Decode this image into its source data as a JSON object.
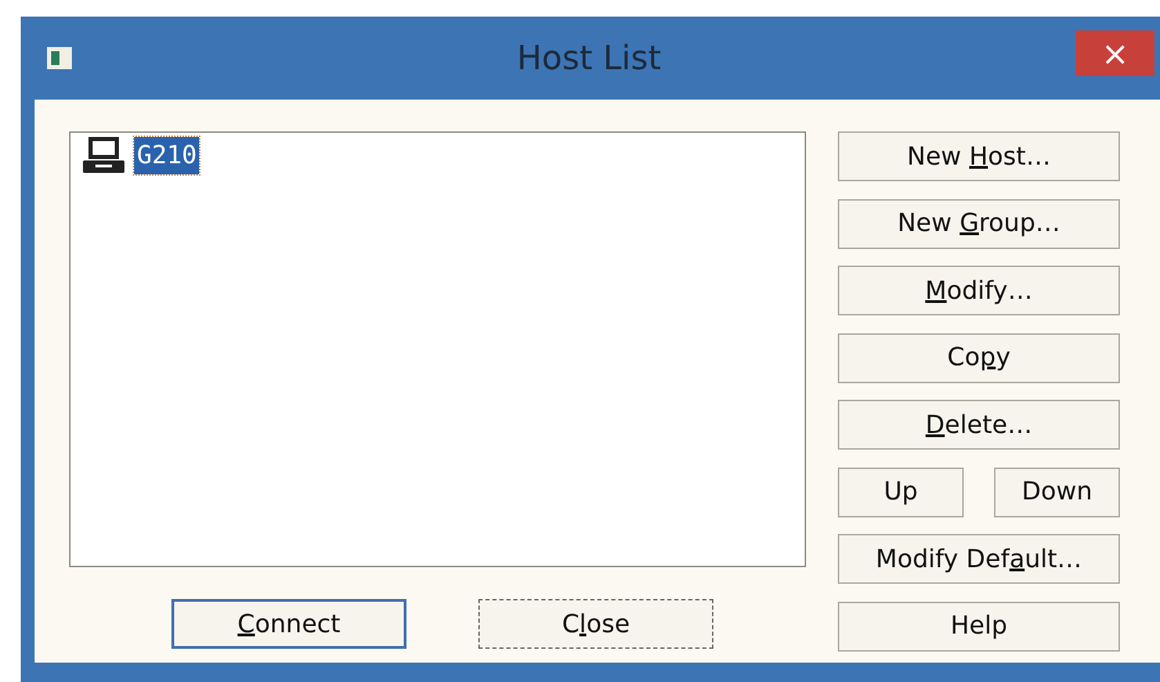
{
  "window": {
    "title": "Host List",
    "close_glyph": "×"
  },
  "host_list": {
    "items": [
      {
        "label": "G210",
        "selected": true
      }
    ]
  },
  "side_buttons": [
    {
      "label": [
        {
          "text": "New "
        },
        {
          "text": "H",
          "underlined": true
        },
        {
          "text": "ost…"
        }
      ],
      "kind": "wide"
    },
    {
      "label": [
        {
          "text": "New "
        },
        {
          "text": "G",
          "underlined": true
        },
        {
          "text": "roup…"
        }
      ],
      "kind": "wide"
    },
    {
      "label": [
        {
          "text": "M",
          "underlined": true
        },
        {
          "text": "odify…"
        }
      ],
      "kind": "wide"
    },
    {
      "label": [
        {
          "text": "Co"
        },
        {
          "text": "p",
          "underlined": true
        },
        {
          "text": "y"
        }
      ],
      "kind": "wide"
    },
    {
      "label": [
        {
          "text": "D",
          "underlined": true
        },
        {
          "text": "elete…"
        }
      ],
      "kind": "wide"
    },
    {
      "label": [
        {
          "text": "Up"
        }
      ],
      "kind": "half"
    },
    {
      "label": [
        {
          "text": "Down"
        }
      ],
      "kind": "half"
    },
    {
      "label": [
        {
          "text": "Modify Def"
        },
        {
          "text": "a",
          "underlined": true
        },
        {
          "text": "ult…"
        }
      ],
      "kind": "wide"
    },
    {
      "label": [
        {
          "text": "Help"
        }
      ],
      "kind": "wide"
    }
  ],
  "bottom_buttons": [
    {
      "label": [
        {
          "text": "C",
          "underlined": true
        },
        {
          "text": "onnect"
        }
      ],
      "default": true,
      "focused": false
    },
    {
      "label": [
        {
          "text": "C"
        },
        {
          "text": "l",
          "underlined": true
        },
        {
          "text": "ose"
        }
      ],
      "default": false,
      "focused": true
    }
  ]
}
